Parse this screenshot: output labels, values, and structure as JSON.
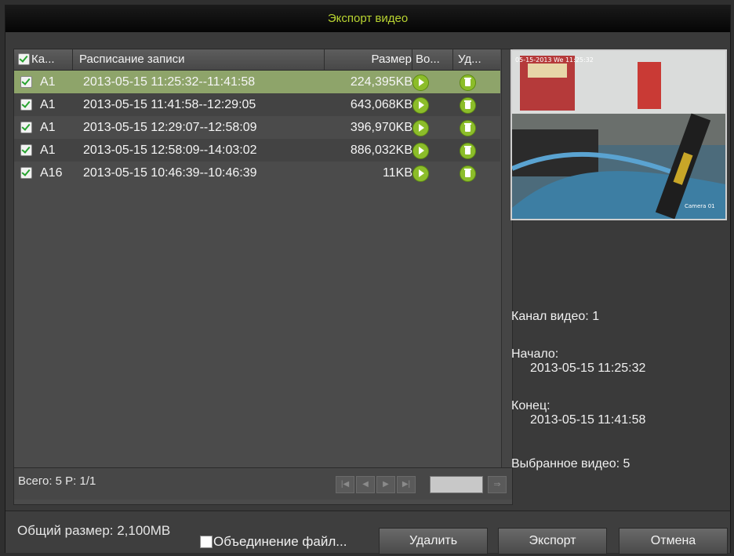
{
  "window": {
    "title": "Экспорт видео"
  },
  "table": {
    "headers": {
      "channel": "Ка...",
      "schedule": "Расписание записи",
      "size": "Размер",
      "play": "Во...",
      "delete": "Уд..."
    },
    "rows": [
      {
        "channel": "A1",
        "range": "2013-05-15 11:25:32--11:41:58",
        "size": "224,395KB",
        "checked": true,
        "selected": true
      },
      {
        "channel": "A1",
        "range": "2013-05-15 11:41:58--12:29:05",
        "size": "643,068KB",
        "checked": true,
        "selected": false
      },
      {
        "channel": "A1",
        "range": "2013-05-15 12:29:07--12:58:09",
        "size": "396,970KB",
        "checked": true,
        "selected": false
      },
      {
        "channel": "A1",
        "range": "2013-05-15 12:58:09--14:03:02",
        "size": "886,032KB",
        "checked": true,
        "selected": false
      },
      {
        "channel": "A16",
        "range": "2013-05-15 10:46:39--10:46:39",
        "size": "11KB",
        "checked": true,
        "selected": false
      }
    ],
    "footer": {
      "total": "Всего: 5  P: 1/1"
    }
  },
  "preview": {
    "overlay_timestamp": "05-15-2013 We 11:25:32",
    "overlay_camera": "Camera 01"
  },
  "info": {
    "channel": "Канал видео: 1",
    "start_label": "Начало:",
    "start_value": "2013-05-15 11:25:32",
    "end_label": "Конец:",
    "end_value": "2013-05-15 11:41:58",
    "selected": "Выбранное видео: 5"
  },
  "bottom": {
    "total_size": "Общий размер: 2,100MB",
    "merge_label": "Объединение файл...",
    "merge_checked": false,
    "delete_button": "Удалить",
    "export_button": "Экспорт",
    "cancel_button": "Отмена"
  },
  "colors": {
    "title": "#b9d431",
    "selected_row": "#8ea46a",
    "icon_green": "#8cbd2a"
  },
  "icons": {
    "play": "play-icon",
    "delete": "trash-icon"
  }
}
